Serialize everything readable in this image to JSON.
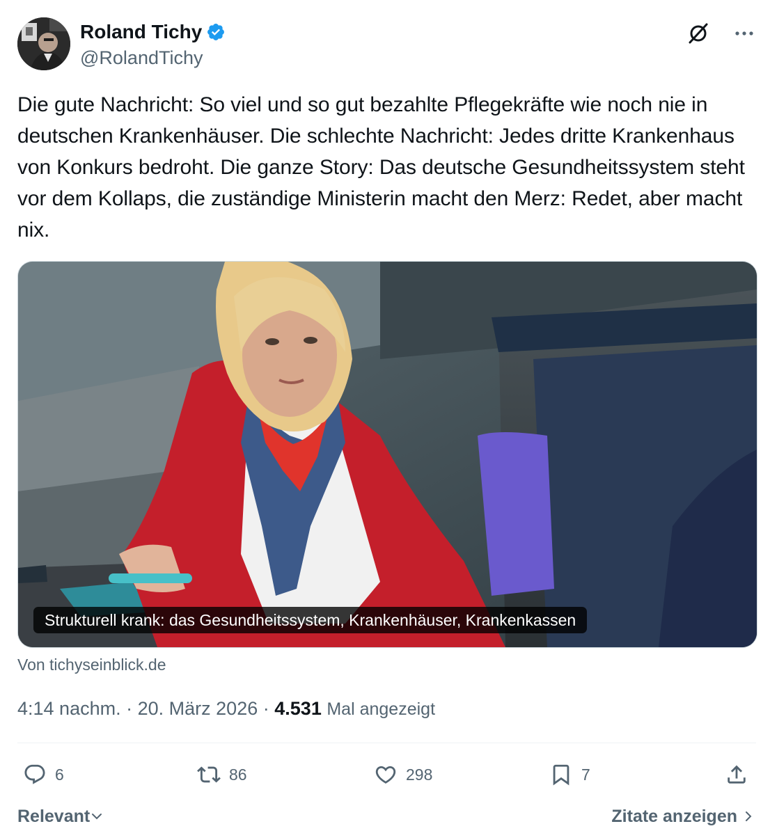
{
  "author": {
    "name": "Roland Tichy",
    "handle": "@RolandTichy"
  },
  "tweet": {
    "text": "Die gute Nachricht: So viel und so gut bezahlte Pflegekräfte wie noch nie in deutschen Krankenhäuser. Die schlechte Nachricht: Jedes dritte Krankenhaus von Konkurs bedroht. Die ganze Story: Das deutsche Gesundheitssystem steht vor dem Kollaps, die zuständige Ministerin macht den Merz: Redet, aber macht nix."
  },
  "card": {
    "caption": "Strukturell krank: das Gesundheitssystem, Krankenhäuser, Krankenkassen",
    "source": "Von tichyseinblick.de"
  },
  "meta": {
    "time": "4:14 nachm.",
    "separator": "·",
    "date": "20. März 2026",
    "views_count": "4.531",
    "views_label": "Mal angezeigt"
  },
  "actions": {
    "replies": "6",
    "reposts": "86",
    "likes": "298",
    "bookmarks": "7"
  },
  "footer": {
    "sort_label": "Relevant",
    "quotes_label": "Zitate anzeigen"
  },
  "colors": {
    "text": "#0f1419",
    "secondary": "#536471",
    "verified": "#1d9bf0",
    "border": "#cfd9de"
  },
  "icons": [
    "verified-badge-icon",
    "grok-icon",
    "more-icon",
    "reply-icon",
    "repost-icon",
    "like-icon",
    "bookmark-icon",
    "share-icon",
    "chevron-down-icon",
    "chevron-right-icon"
  ]
}
